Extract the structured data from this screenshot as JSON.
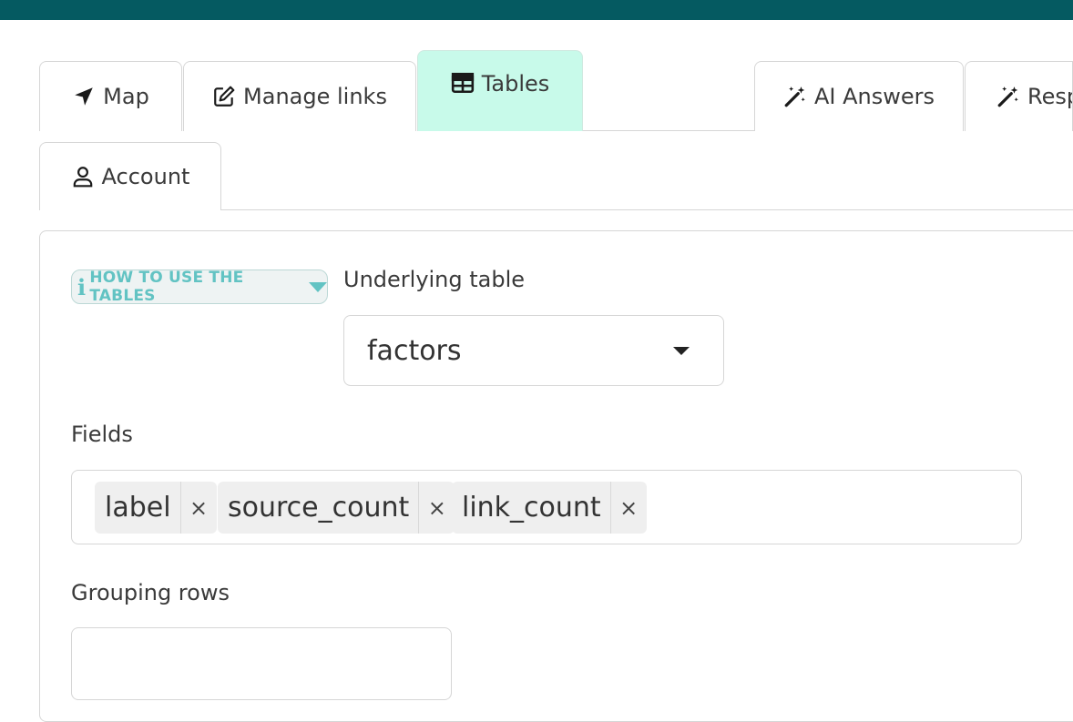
{
  "tabs": [
    {
      "label": "Map",
      "icon": "navigation-arrow-icon"
    },
    {
      "label": "Manage links",
      "icon": "edit-icon"
    },
    {
      "label": "Tables",
      "icon": "table-icon",
      "active": true
    },
    {
      "label": "AI Answers",
      "icon": "magic-wand-icon"
    },
    {
      "label": "Resp",
      "icon": "magic-wand-icon"
    },
    {
      "label": "Account",
      "icon": "user-icon"
    }
  ],
  "help_button": {
    "icon_glyph": "i",
    "label": "HOW TO USE THE TABLES"
  },
  "underlying_table": {
    "label": "Underlying table",
    "value": "factors"
  },
  "fields": {
    "label": "Fields",
    "chips": [
      {
        "text": "label",
        "remove": "×"
      },
      {
        "text": "source_count",
        "remove": "×"
      },
      {
        "text": "link_count",
        "remove": "×"
      }
    ]
  },
  "grouping_rows": {
    "label": "Grouping rows",
    "value": ""
  },
  "colors": {
    "topbar": "#055a61",
    "active_tab": "#c8faea",
    "help_accent": "#62c3c3"
  }
}
